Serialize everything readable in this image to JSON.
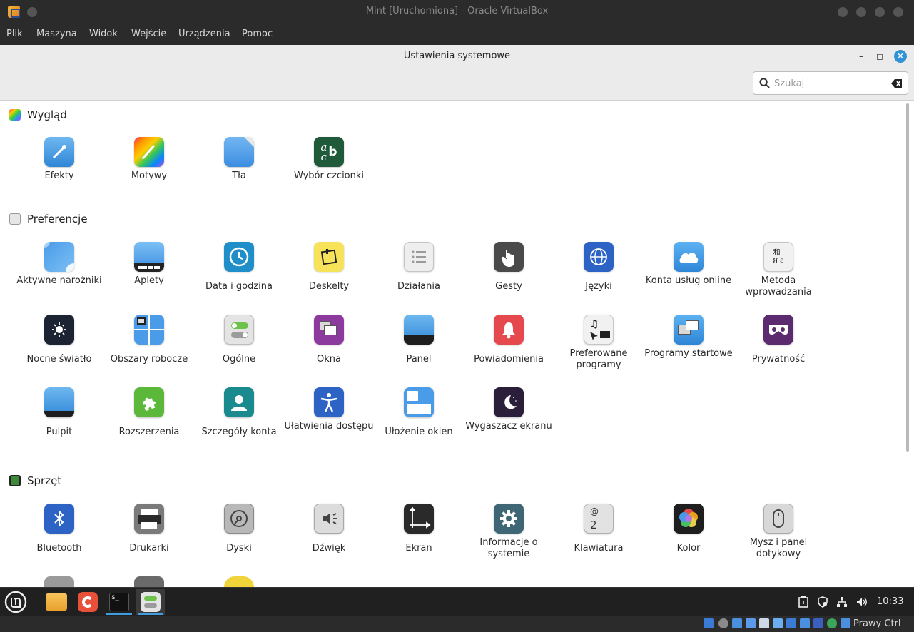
{
  "vbox": {
    "title": "Mint [Uruchomiona] - Oracle VirtualBox",
    "menu": [
      "Plik",
      "Maszyna",
      "Widok",
      "Wejście",
      "Urządzenia",
      "Pomoc"
    ],
    "host_key": "Prawy Ctrl"
  },
  "settings": {
    "title": "Ustawienia systemowe",
    "search_placeholder": "Szukaj",
    "sections": [
      {
        "label": "Wygląd",
        "items": [
          {
            "label": "Efekty",
            "icon": "effects-icon"
          },
          {
            "label": "Motywy",
            "icon": "themes-icon"
          },
          {
            "label": "Tła",
            "icon": "backgrounds-icon"
          },
          {
            "label": "Wybór czcionki",
            "icon": "font-selection-icon"
          }
        ]
      },
      {
        "label": "Preferencje",
        "items": [
          {
            "label": "Aktywne narożniki",
            "icon": "hot-corners-icon"
          },
          {
            "label": "Aplety",
            "icon": "applets-icon"
          },
          {
            "label": "Data i godzina",
            "icon": "clock-icon"
          },
          {
            "label": "Deskelty",
            "icon": "desklets-icon"
          },
          {
            "label": "Działania",
            "icon": "actions-icon"
          },
          {
            "label": "Gesty",
            "icon": "gestures-icon"
          },
          {
            "label": "Języki",
            "icon": "languages-icon"
          },
          {
            "label": "Konta usług online",
            "icon": "online-accounts-icon"
          },
          {
            "label": "Metoda wprowadzania",
            "icon": "input-method-icon"
          },
          {
            "label": "Nocne światło",
            "icon": "night-light-icon"
          },
          {
            "label": "Obszary robocze",
            "icon": "workspaces-icon"
          },
          {
            "label": "Ogólne",
            "icon": "general-icon"
          },
          {
            "label": "Okna",
            "icon": "windows-icon"
          },
          {
            "label": "Panel",
            "icon": "panel-icon"
          },
          {
            "label": "Powiadomienia",
            "icon": "notifications-icon"
          },
          {
            "label": "Preferowane programy",
            "icon": "preferred-apps-icon"
          },
          {
            "label": "Programy startowe",
            "icon": "startup-apps-icon"
          },
          {
            "label": "Prywatność",
            "icon": "privacy-icon"
          },
          {
            "label": "Pulpit",
            "icon": "desktop-icon"
          },
          {
            "label": "Rozszerzenia",
            "icon": "extensions-icon"
          },
          {
            "label": "Szczegóły konta",
            "icon": "account-details-icon"
          },
          {
            "label": "Ułatwienia dostępu",
            "icon": "accessibility-icon"
          },
          {
            "label": "Ułożenie okien",
            "icon": "window-tiling-icon"
          },
          {
            "label": "Wygaszacz ekranu",
            "icon": "screensaver-icon"
          }
        ]
      },
      {
        "label": "Sprzęt",
        "items": [
          {
            "label": "Bluetooth",
            "icon": "bluetooth-icon"
          },
          {
            "label": "Drukarki",
            "icon": "printer-icon"
          },
          {
            "label": "Dyski",
            "icon": "disks-icon"
          },
          {
            "label": "Dźwięk",
            "icon": "sound-icon"
          },
          {
            "label": "Ekran",
            "icon": "display-icon"
          },
          {
            "label": "Informacje o systemie",
            "icon": "system-info-icon"
          },
          {
            "label": "Klawiatura",
            "icon": "keyboard-icon"
          },
          {
            "label": "Kolor",
            "icon": "color-icon"
          },
          {
            "label": "Mysz i panel dotykowy",
            "icon": "mouse-icon"
          }
        ]
      }
    ]
  },
  "taskbar": {
    "clock": "10:33",
    "apps": [
      "menu-icon",
      "files-icon",
      "firefox-icon",
      "terminal-icon",
      "system-settings-icon"
    ]
  }
}
